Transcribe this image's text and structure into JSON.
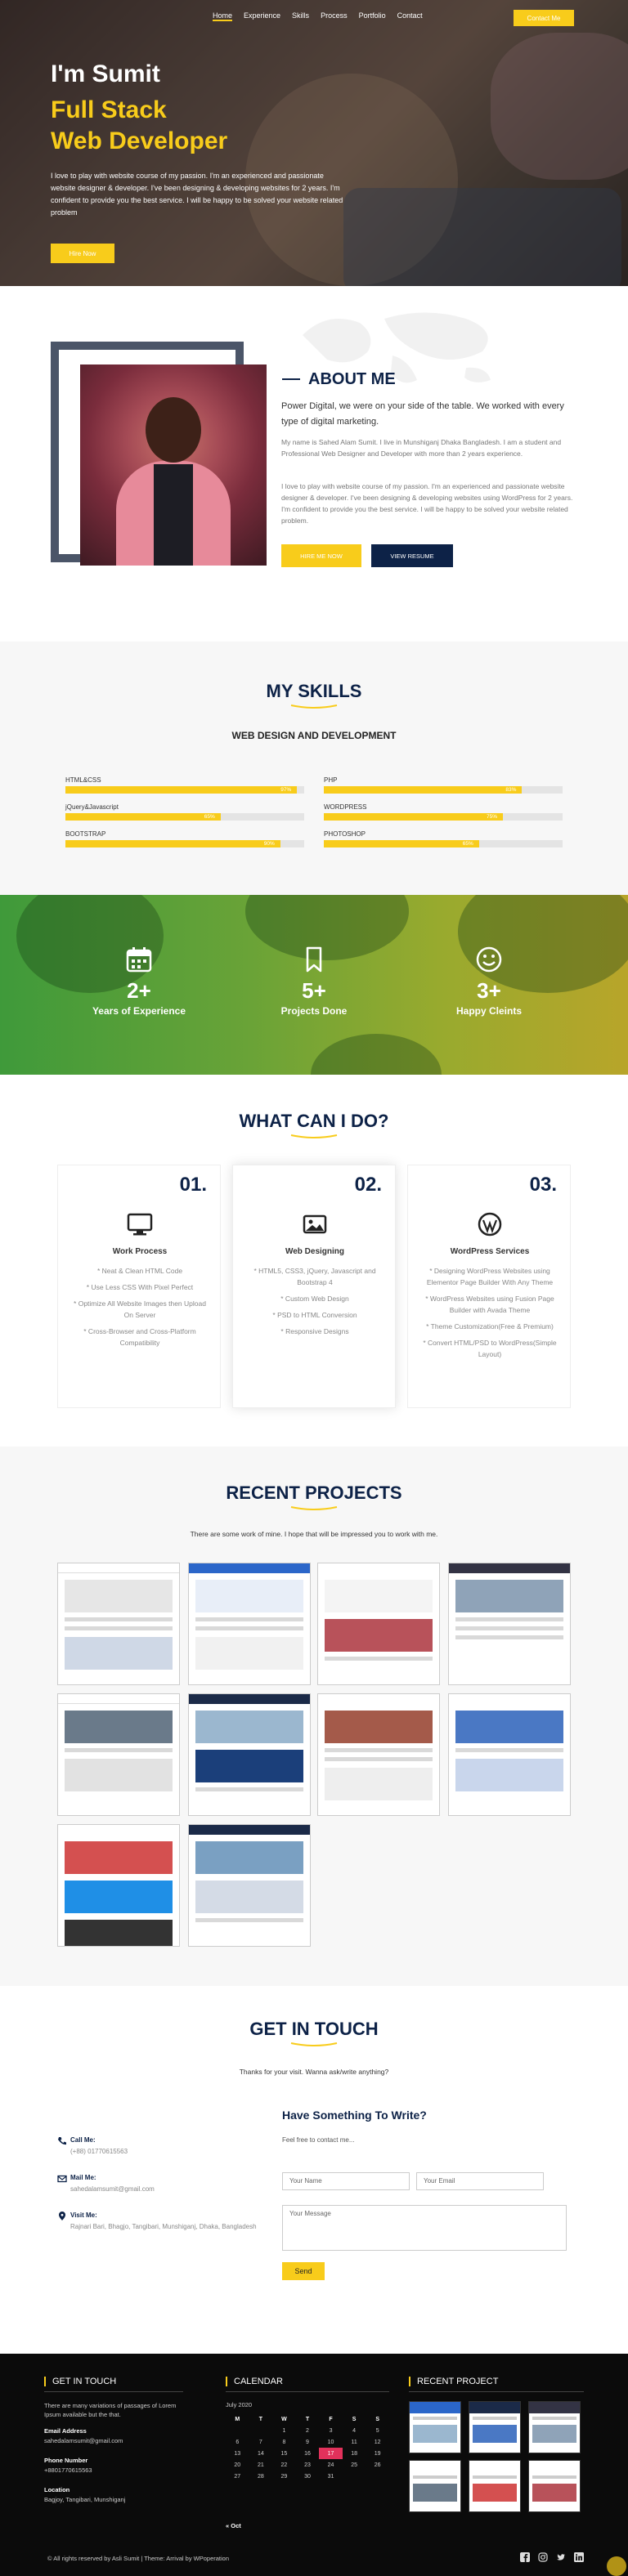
{
  "nav": {
    "items": [
      "Home",
      "Experience",
      "Skills",
      "Process",
      "Portfolio",
      "Contact"
    ],
    "cta": "Contact Me"
  },
  "hero": {
    "hello": "I'm Sumit",
    "title_line1": "Full Stack",
    "title_line2": "Web Developer",
    "text": "I love to play with website course of my passion. I'm an experienced and passionate website designer & developer. I've been designing & developing websites for 2 years. I'm confident to provide you the best service. I will be happy to be solved your website related problem",
    "button": "Hire Now"
  },
  "about": {
    "title": "ABOUT ME",
    "lead": "Power Digital, we were on your side of the table. We worked with every type of digital marketing.",
    "p1": "My name is Sahed Alam Sumit. I live in Munshiganj Dhaka Bangladesh. I am a student and Professional Web Designer and Developer with more than 2 years experience.",
    "p2": "I love to play with website course of my passion. I'm an experienced and passionate website designer & developer. I've been designing & developing websites using WordPress for 2 years. I'm confident to provide you the best service. I will be happy to be solved your website related problem.",
    "btn_hire": "HIRE ME NOW",
    "btn_resume": "VIEW RESUME"
  },
  "skills": {
    "title": "MY SKILLS",
    "subtitle": "WEB DESIGN AND DEVELOPMENT",
    "items": [
      {
        "name": "HTML&CSS",
        "percent": 97,
        "label": "97%"
      },
      {
        "name": "PHP",
        "percent": 83,
        "label": "83%"
      },
      {
        "name": "jQuery&Javascript",
        "percent": 65,
        "label": "65%"
      },
      {
        "name": "WORDPRESS",
        "percent": 75,
        "label": "75%"
      },
      {
        "name": "BOOTSTRAP",
        "percent": 90,
        "label": "90%"
      },
      {
        "name": "PHOTOSHOP",
        "percent": 65,
        "label": "65%"
      }
    ]
  },
  "stats": [
    {
      "icon": "calendar-icon",
      "num": "2+",
      "label": "Years of Experience"
    },
    {
      "icon": "bookmark-icon",
      "num": "5+",
      "label": "Projects Done"
    },
    {
      "icon": "smiley-icon",
      "num": "3+",
      "label": "Happy Cleints"
    }
  ],
  "services": {
    "title": "WHAT CAN I DO?",
    "cards": [
      {
        "no": "01.",
        "icon": "monitor-icon",
        "title": "Work Process",
        "items": [
          "* Neat & Clean HTML Code",
          "* Use Less CSS With Pixel Perfect",
          "* Optimize All Website Images then Upload On Server",
          "* Cross-Browser and Cross-Platform Compatibility"
        ]
      },
      {
        "no": "02.",
        "icon": "image-icon",
        "title": "Web Designing",
        "items": [
          "* HTML5, CSS3, jQuery, Javascript and Bootstrap 4",
          "* Custom Web Design",
          "* PSD to HTML Conversion",
          "* Responsive Designs"
        ]
      },
      {
        "no": "03.",
        "icon": "wordpress-icon",
        "title": "WordPress Services",
        "items": [
          "* Designing WordPress Websites using Elementor Page Builder With Any Theme",
          "* WordPress Websites using Fusion Page Builder with Avada Theme",
          "* Theme Customization(Free & Premium)",
          "* Convert HTML/PSD to WordPress(Simple Layout)"
        ]
      }
    ]
  },
  "projects": {
    "title": "RECENT PROJECTS",
    "subtitle": "There are some work of mine. I hope that will be impressed you to work with me."
  },
  "contact": {
    "title": "GET IN TOUCH",
    "subtitle": "Thanks for your visit. Wanna ask/write anything?",
    "call_label": "Call Me:",
    "call_value": "(+88) 01770615563",
    "mail_label": "Mail Me:",
    "mail_value": "sahedalamsumit@gmail.com",
    "visit_label": "Visit Me:",
    "visit_value": "Rajnari Bari, Bhagjo, Tangibari, Munshiganj, Dhaka, Bangladesh",
    "form_title": "Have Something To Write?",
    "form_sub": "Feel free to contact me...",
    "name_placeholder": "Your Name",
    "email_placeholder": "Your Email",
    "message_placeholder": "Your Message",
    "send": "Send"
  },
  "footer": {
    "col1_title": "GET IN TOUCH",
    "col1_text": "There are many variations of passages of Lorem Ipsum available but the that.",
    "email_label": "Email Address",
    "email_value": "sahedalamsumit@gmail.com",
    "phone_label": "Phone Number",
    "phone_value": "+8801770615563",
    "location_label": "Location",
    "location_value": "Bagjoy, Tangibari, Munshiganj",
    "col2_title": "CALENDAR",
    "month": "July 2020",
    "days": [
      "M",
      "T",
      "W",
      "T",
      "F",
      "S",
      "S"
    ],
    "weeks": [
      [
        "",
        "",
        "1",
        "2",
        "3",
        "4",
        "5"
      ],
      [
        "6",
        "7",
        "8",
        "9",
        "10",
        "11",
        "12"
      ],
      [
        "13",
        "14",
        "15",
        "16",
        "17",
        "18",
        "19"
      ],
      [
        "20",
        "21",
        "22",
        "23",
        "24",
        "25",
        "26"
      ],
      [
        "27",
        "28",
        "29",
        "30",
        "31",
        "",
        ""
      ]
    ],
    "today": "17",
    "prev": "« Oct",
    "col3_title": "RECENT PROJECT",
    "copyright": "© All rights reserved by Asli Sumit | Theme: Arrival by WPoperation",
    "social": [
      "facebook-icon",
      "instagram-icon",
      "twitter-icon",
      "linkedin-icon"
    ]
  },
  "colors": {
    "accent": "#f8cc1b",
    "navy": "#0d2247",
    "today": "#e2315b"
  }
}
